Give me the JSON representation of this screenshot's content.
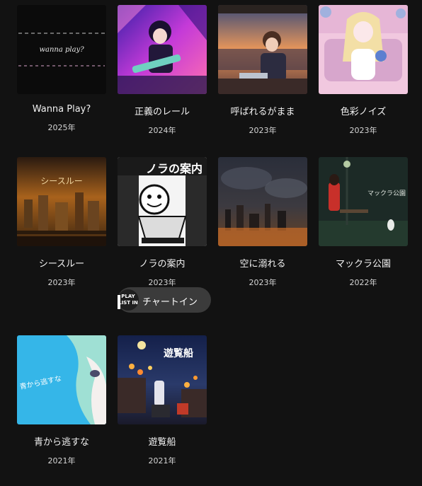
{
  "albums": [
    {
      "title": "Wanna Play?",
      "year": "2025年",
      "cover_text": "wanna play?"
    },
    {
      "title": "正義のレール",
      "year": "2024年"
    },
    {
      "title": "呼ばれるがまま",
      "year": "2023年"
    },
    {
      "title": "色彩ノイズ",
      "year": "2023年"
    },
    {
      "title": "シースルー",
      "year": "2023年",
      "cover_text": "シースルー"
    },
    {
      "title": "ノラの案内",
      "year": "2023年",
      "cover_text": "ノラの案内"
    },
    {
      "title": "空に溺れる",
      "year": "2023年"
    },
    {
      "title": "マックラ公園",
      "year": "2022年",
      "cover_text": "マックラ公園"
    },
    {
      "title": "青から逃すな",
      "year": "2021年",
      "cover_text": "青から逃すな"
    },
    {
      "title": "遊覧船",
      "year": "2021年",
      "cover_text": "遊覧船"
    }
  ],
  "chart_badge": {
    "logo_line1": "PLAY",
    "logo_line2": "LIST IN",
    "label": "チャートイン"
  },
  "colors": {
    "background": "#121212",
    "badge_background": "#3b3b3b"
  }
}
